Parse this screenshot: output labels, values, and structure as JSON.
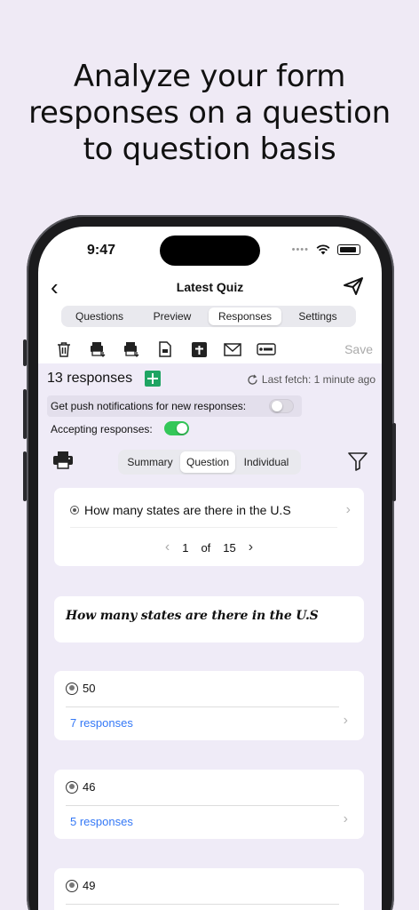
{
  "headline": {
    "line1": "Analyze your form",
    "line2": "responses on a question",
    "line3": "to question basis"
  },
  "status_bar": {
    "time": "9:47",
    "dots": "••••"
  },
  "navbar": {
    "title": "Latest Quiz"
  },
  "tabs": [
    {
      "label": "Questions",
      "active": false
    },
    {
      "label": "Preview",
      "active": false
    },
    {
      "label": "Responses",
      "active": true
    },
    {
      "label": "Settings",
      "active": false
    }
  ],
  "toolbar": {
    "icons": [
      "trash-icon",
      "download-csv-icon",
      "download-xlsx-icon",
      "document-icon",
      "sheet-plus-icon",
      "mail-icon",
      "record-icon"
    ],
    "save_label": "Save"
  },
  "responses": {
    "count_label": "13 responses",
    "last_fetch": "Last fetch: 1 minute ago",
    "push_label": "Get push notifications for new responses:",
    "push_enabled": false,
    "accepting_label": "Accepting responses:",
    "accepting_enabled": true
  },
  "view_tabs": [
    {
      "label": "Summary",
      "active": false
    },
    {
      "label": "Question",
      "active": true
    },
    {
      "label": "Individual",
      "active": false
    }
  ],
  "question_selector": {
    "question": "How many states are there in the U.S",
    "current": "1",
    "of_label": "of",
    "total": "15"
  },
  "question_title": "How many states are there in the U.S",
  "options": [
    {
      "value": "50",
      "responses": "7 responses"
    },
    {
      "value": "46",
      "responses": "5 responses"
    },
    {
      "value": "49",
      "responses": ""
    }
  ],
  "colors": {
    "background": "#efeaf5",
    "accent_green": "#34c759",
    "link_blue": "#3478f6",
    "sheets_green": "#1fa463"
  }
}
